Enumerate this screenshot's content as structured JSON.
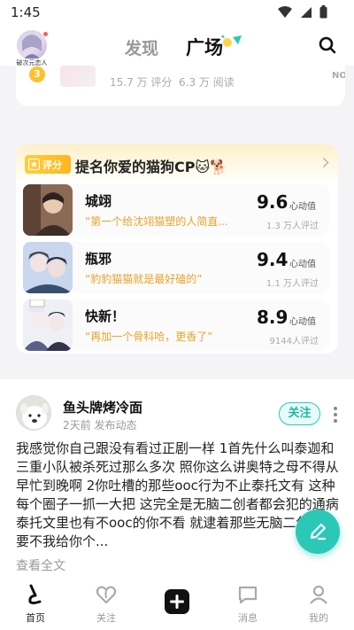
{
  "status_bar": {
    "time": "1:45"
  },
  "header": {
    "avatar_caption": "破次元恋人",
    "tab_discover": "发现",
    "tab_plaza": "广场"
  },
  "ranking_strip": {
    "rank": "3",
    "ratings": "15.7 万 评分",
    "reads": "6.3 万 阅读",
    "next_label": "NO."
  },
  "cp_section": {
    "badge": "评分",
    "title": "提名你爱的猫狗CP🐱🐕",
    "score_unit": "心动值",
    "items": [
      {
        "name": "城翊",
        "quote": "“第一个给沈翊猫塑的人简直...",
        "score": "9.6",
        "raters": "1.3 万人评过"
      },
      {
        "name": "瓶邪",
        "quote": "“豹豹猫猫就是最好磕的”",
        "score": "9.4",
        "raters": "1.1 万人评过"
      },
      {
        "name": "快新！",
        "quote": "“再加一个骨科哈，更香了”",
        "score": "8.9",
        "raters": "9144人评过"
      }
    ]
  },
  "post": {
    "author": "鱼头牌烤冷面",
    "meta": "2天前 发布动态",
    "follow_label": "关注",
    "body": "我感觉你自己跟没有看过正剧一样 1首先什么叫泰迦和三重小队被杀死过那么多次 照你这么讲奥特之母不得从早忙到晚啊 2你吐槽的那些ooc行为不止泰托文有 这种每个圈子一抓一大把 这完全是无脑二创者都会犯的通病 泰托文里也有不ooc的你不看 就逮着那些无脑二创文喷 要不我给你个...",
    "read_more": "查看全文"
  },
  "bottom_nav": {
    "home": "首页",
    "follow": "关注",
    "messages": "消息",
    "me": "我的"
  },
  "colors": {
    "accent": "#2cc8b7",
    "gold": "#ffc02e",
    "quote": "#e8a42c"
  }
}
